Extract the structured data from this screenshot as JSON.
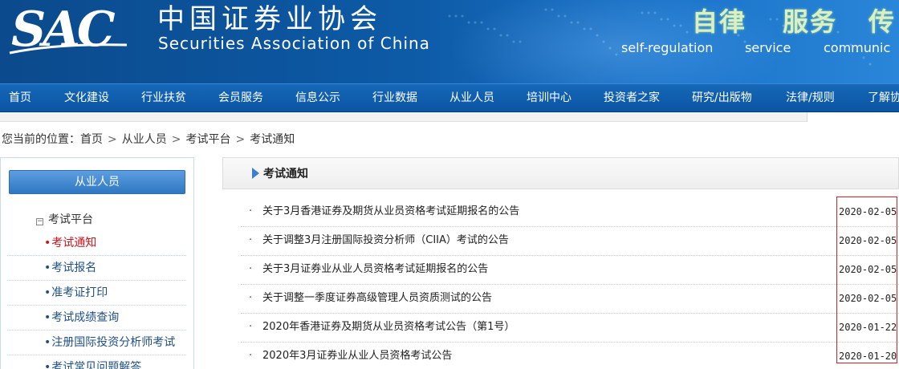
{
  "header": {
    "logo_text": "SAC",
    "org_name_cn": "中国证券业协会",
    "org_name_en": "Securities Association of China",
    "motto": [
      {
        "cn": "自律",
        "en": "self-regulation"
      },
      {
        "cn": "服务",
        "en": "service"
      },
      {
        "cn": "传",
        "en": "communic"
      }
    ]
  },
  "nav": {
    "items": [
      "首页",
      "文化建设",
      "行业扶贫",
      "会员服务",
      "信息公示",
      "行业数据",
      "从业人员",
      "培训中心",
      "投资者之家",
      "研究/出版物",
      "法律/规则",
      "了解协"
    ]
  },
  "breadcrumb": {
    "prefix": "您当前的位置：",
    "items": [
      "首页",
      "从业人员",
      "考试平台",
      "考试通知"
    ],
    "separator": ">"
  },
  "sidebar": {
    "heading": "从业人员",
    "group_label": "考试平台",
    "group_toggle": "−",
    "bullet": "•",
    "items": [
      "考试通知",
      "考试报名",
      "准考证打印",
      "考试成绩查询",
      "注册国际投资分析师考试",
      "考试常见问题解答"
    ],
    "active_index": 0
  },
  "main": {
    "section_title": "考试通知",
    "bullet": "·",
    "notices": [
      {
        "title": "关于3月香港证券及期货从业员资格考试延期报名的公告",
        "date": "2020-02-05"
      },
      {
        "title": "关于调整3月注册国际投资分析师（CIIA）考试的公告",
        "date": "2020-02-05"
      },
      {
        "title": "关于3月证券业从业人员资格考试延期报名的公告",
        "date": "2020-02-05"
      },
      {
        "title": "关于调整一季度证券高级管理人员资质测试的公告",
        "date": "2020-02-05"
      },
      {
        "title": "2020年香港证券及期货从业员资格考试公告（第1号）",
        "date": "2020-01-22"
      },
      {
        "title": "2020年3月证券业从业人员资格考试公告",
        "date": "2020-01-20"
      }
    ]
  },
  "colors": {
    "header_blue": "#0d5aa6",
    "nav_blue": "#0a55a3",
    "active_red": "#d0121b",
    "motto_green": "#d9f0c2",
    "highlight_red": "#e02020"
  }
}
